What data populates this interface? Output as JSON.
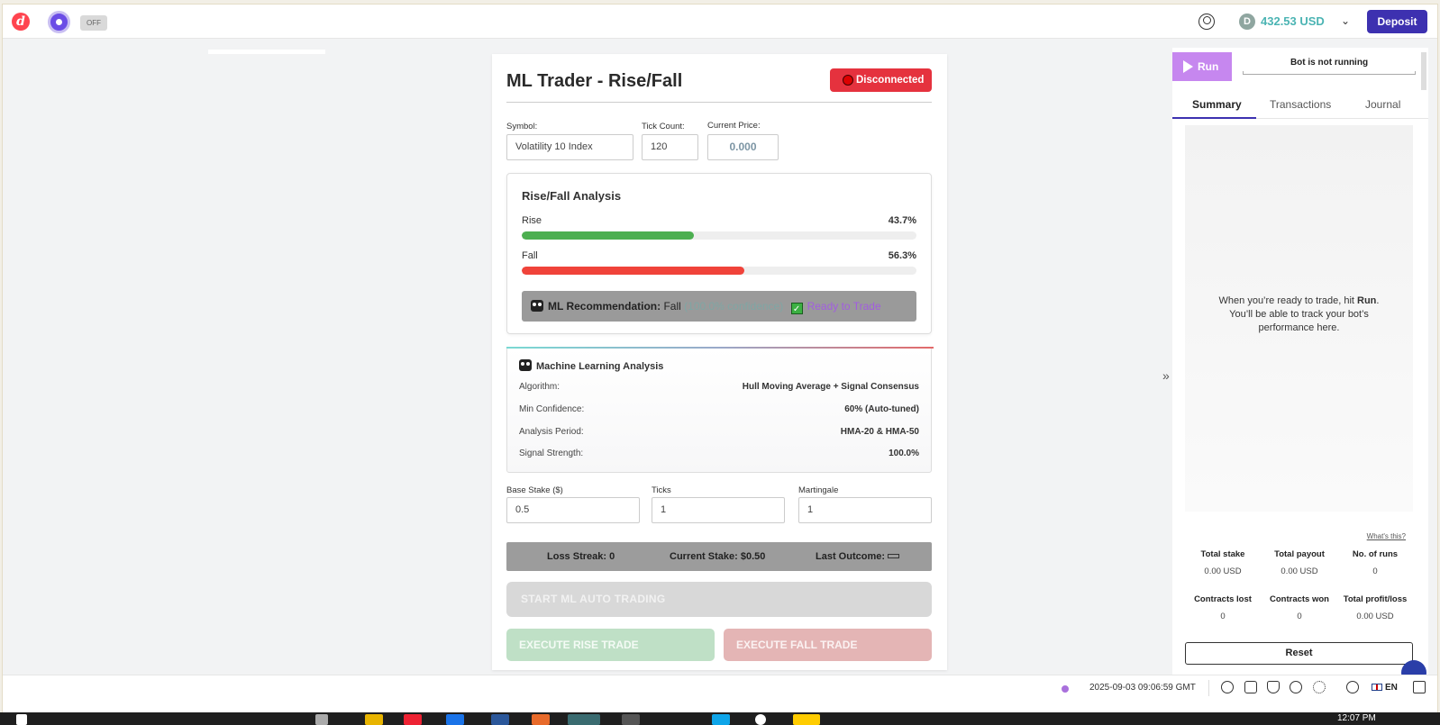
{
  "header": {
    "toggle_label": "OFF",
    "balance": "432.53 USD",
    "coin_symbol": "D",
    "deposit_label": "Deposit"
  },
  "card": {
    "title": "ML Trader - Rise/Fall",
    "status_label": "Disconnected",
    "symbol_label": "Symbol:",
    "symbol_value": "Volatility 10 Index",
    "tick_count_label": "Tick Count:",
    "tick_count_value": "120",
    "current_price_label": "Current Price:",
    "current_price_value": "0.000"
  },
  "analysis": {
    "title": "Rise/Fall Analysis",
    "rise_label": "Rise",
    "rise_pct": "43.7%",
    "rise_fraction": 0.437,
    "fall_label": "Fall",
    "fall_pct": "56.3%",
    "fall_fraction": 0.563,
    "recommendation_label": "ML Recommendation:",
    "recommendation_value": "Fall",
    "recommendation_confidence": "(100.0% confidence)",
    "ready_label": "Ready to Trade",
    "colors": {
      "rise": "#4caf50",
      "fall": "#f0433a",
      "confidence": "#7fa6a4",
      "ready": "#a25de0"
    }
  },
  "ml": {
    "title": "Machine Learning Analysis",
    "rows": [
      {
        "key": "Algorithm:",
        "value": "Hull Moving Average + Signal Consensus"
      },
      {
        "key": "Min Confidence:",
        "value": "60% (Auto-tuned)"
      },
      {
        "key": "Analysis Period:",
        "value": "HMA-20 & HMA-50"
      },
      {
        "key": "Signal Strength:",
        "value": "100.0%"
      }
    ]
  },
  "settings": {
    "base_stake_label": "Base Stake ($)",
    "base_stake_value": "0.5",
    "ticks_label": "Ticks",
    "ticks_value": "1",
    "martingale_label": "Martingale",
    "martingale_value": "1"
  },
  "stats": {
    "loss_streak": "Loss Streak: 0",
    "current_stake": "Current Stake: $0.50",
    "last_outcome": "Last Outcome:"
  },
  "buttons": {
    "start": "START ML AUTO TRADING",
    "rise": "EXECUTE RISE TRADE",
    "fall": "EXECUTE FALL TRADE"
  },
  "right_panel": {
    "run_label": "Run",
    "bot_status": "Bot is not running",
    "tabs": [
      "Summary",
      "Transactions",
      "Journal"
    ],
    "empty_line1": "When you’re ready to trade, hit",
    "empty_bold": "Run",
    "empty_line2": "You’ll be able to track your bot’s",
    "empty_line3": "performance here.",
    "whats_this": "What's this?",
    "summary": [
      {
        "key": "Total stake",
        "value": "0.00 USD"
      },
      {
        "key": "Total payout",
        "value": "0.00 USD"
      },
      {
        "key": "No. of runs",
        "value": "0"
      },
      {
        "key": "Contracts lost",
        "value": "0"
      },
      {
        "key": "Contracts won",
        "value": "0"
      },
      {
        "key": "Total profit/loss",
        "value": "0.00 USD"
      }
    ],
    "reset_label": "Reset"
  },
  "footer": {
    "timestamp": "2025-09-03 09:06:59 GMT",
    "language": "EN"
  },
  "taskbar": {
    "clock": "12:07 PM"
  }
}
